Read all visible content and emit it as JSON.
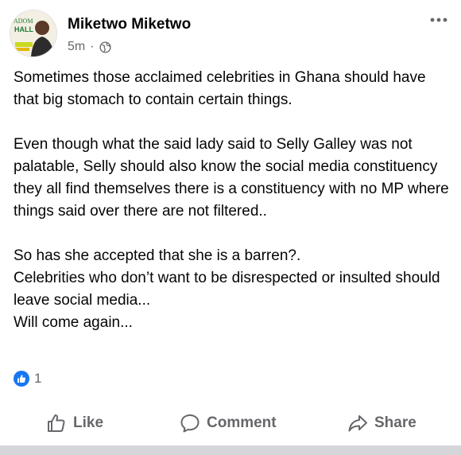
{
  "post": {
    "author": "Miketwo Miketwo",
    "avatar_text": [
      "ADOM",
      "HALL"
    ],
    "time": "5m",
    "separator": "·",
    "privacy_icon": "globe-icon",
    "more_icon": "more-dots-icon",
    "paragraphs": [
      "Sometimes those acclaimed celebrities in Ghana should have that big stomach to contain certain things.",
      "Even though what the said lady said to Selly Galley was not palatable, Selly should also know the social media constituency they all find themselves there is a constituency with no MP where things said over there are not filtered..",
      "So has she accepted that she is a barren?.\nCelebrities who don’t want to be disrespected or insulted should leave social media...\nWill come again..."
    ],
    "reactions": {
      "icon": "like-reaction-icon",
      "count": "1"
    }
  },
  "actions": {
    "like": "Like",
    "comment": "Comment",
    "share": "Share"
  },
  "colors": {
    "text": "#050505",
    "secondary": "#65676b",
    "like_blue": "#1877f2",
    "divider": "#d4d6da"
  }
}
